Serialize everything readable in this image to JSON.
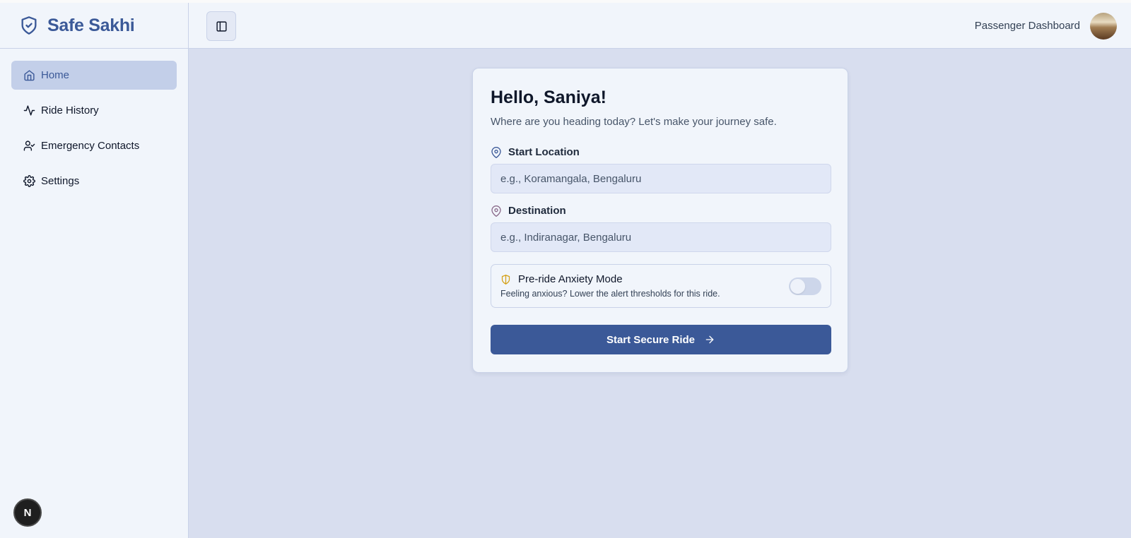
{
  "brand": {
    "name": "Safe Sakhi",
    "logo_icon": "shield-check-icon"
  },
  "sidebar": {
    "items": [
      {
        "label": "Home",
        "icon": "home-icon",
        "active": true
      },
      {
        "label": "Ride History",
        "icon": "activity-icon",
        "active": false
      },
      {
        "label": "Emergency Contacts",
        "icon": "user-check-icon",
        "active": false
      },
      {
        "label": "Settings",
        "icon": "gear-icon",
        "active": false
      }
    ]
  },
  "header": {
    "title": "Passenger Dashboard",
    "toggle_icon": "sidebar-toggle-icon"
  },
  "card": {
    "greeting": "Hello, Saniya!",
    "subtitle": "Where are you heading today? Let's make your journey safe.",
    "start": {
      "label": "Start Location",
      "placeholder": "e.g., Koramangala, Bengaluru",
      "value": ""
    },
    "destination": {
      "label": "Destination",
      "placeholder": "e.g., Indiranagar, Bengaluru",
      "value": ""
    },
    "anxiety": {
      "title": "Pre-ride Anxiety Mode",
      "description": "Feeling anxious? Lower the alert thresholds for this ride.",
      "enabled": false
    },
    "button_label": "Start Secure Ride"
  },
  "badge": {
    "letter": "N"
  },
  "colors": {
    "accent": "#3b5998",
    "background": "#d8deef",
    "panel": "#f1f5fb",
    "warning": "#d4a017"
  }
}
